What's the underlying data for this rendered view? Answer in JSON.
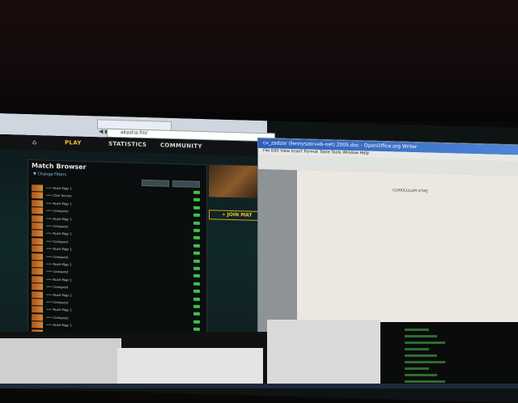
{
  "browser": {
    "tab_label": "",
    "address": "akasha.fm/",
    "nav_icons": "◀ ▶ ↻"
  },
  "site": {
    "nav": {
      "home_icon": "⌂",
      "play": "PLAY",
      "statistics": "STATISTICS",
      "community": "COMMUNITY"
    },
    "match_browser": {
      "title": "Match Browser",
      "change_filters": "▼ Change Filters",
      "rows": [
        {
          "name": "••• Rush Map 1",
          "desc": "",
          "signal": "good"
        },
        {
          "name": "••• Clan Server",
          "desc": "",
          "signal": "good"
        },
        {
          "name": "••• Rush Map 1",
          "desc": "",
          "signal": "good"
        },
        {
          "name": "••• Conquest",
          "desc": "",
          "signal": "good"
        },
        {
          "name": "••• Rush Map 1",
          "desc": "",
          "signal": "good"
        },
        {
          "name": "••• Conquest",
          "desc": "",
          "signal": "good"
        },
        {
          "name": "••• Rush Map 1",
          "desc": "",
          "signal": "good"
        },
        {
          "name": "••• Conquest",
          "desc": "",
          "signal": "good"
        },
        {
          "name": "••• Rush Map 1",
          "desc": "",
          "signal": "good"
        },
        {
          "name": "••• Conquest",
          "desc": "",
          "signal": "good"
        },
        {
          "name": "••• Rush Map 1",
          "desc": "",
          "signal": "good"
        },
        {
          "name": "••• Conquest",
          "desc": "",
          "signal": "good"
        },
        {
          "name": "••• Rush Map 1",
          "desc": "",
          "signal": "good"
        },
        {
          "name": "••• Conquest",
          "desc": "",
          "signal": "good"
        },
        {
          "name": "••• Rush Map 1",
          "desc": "",
          "signal": "good"
        },
        {
          "name": "••• Conquest",
          "desc": "",
          "signal": "good"
        },
        {
          "name": "••• Rush Map 1",
          "desc": "",
          "signal": "good"
        },
        {
          "name": "••• Conquest",
          "desc": "",
          "signal": "good"
        },
        {
          "name": "••• Rush Map 1",
          "desc": "",
          "signal": "good"
        },
        {
          "name": "••• Conquest",
          "desc": "",
          "signal": "good"
        }
      ]
    },
    "side": {
      "join_button": "» JOIN MAT",
      "list": []
    }
  },
  "writer": {
    "title": "cv_zadzor (fennyszerveb-net) 2005.doc - OpenOffice.org Writer",
    "menu": "File  Edit  View  Insert  Format  Table  Tools  Window  Help",
    "doc_heading": "CURRICULUM VITAE",
    "doc_lines": [
      "",
      "",
      "",
      "",
      "",
      "",
      "",
      "",
      "",
      ""
    ]
  },
  "colors": {
    "accent_gold": "#f2c230",
    "signal_green": "#3fbf4a",
    "writer_titlebar": "#2d5fb8"
  }
}
